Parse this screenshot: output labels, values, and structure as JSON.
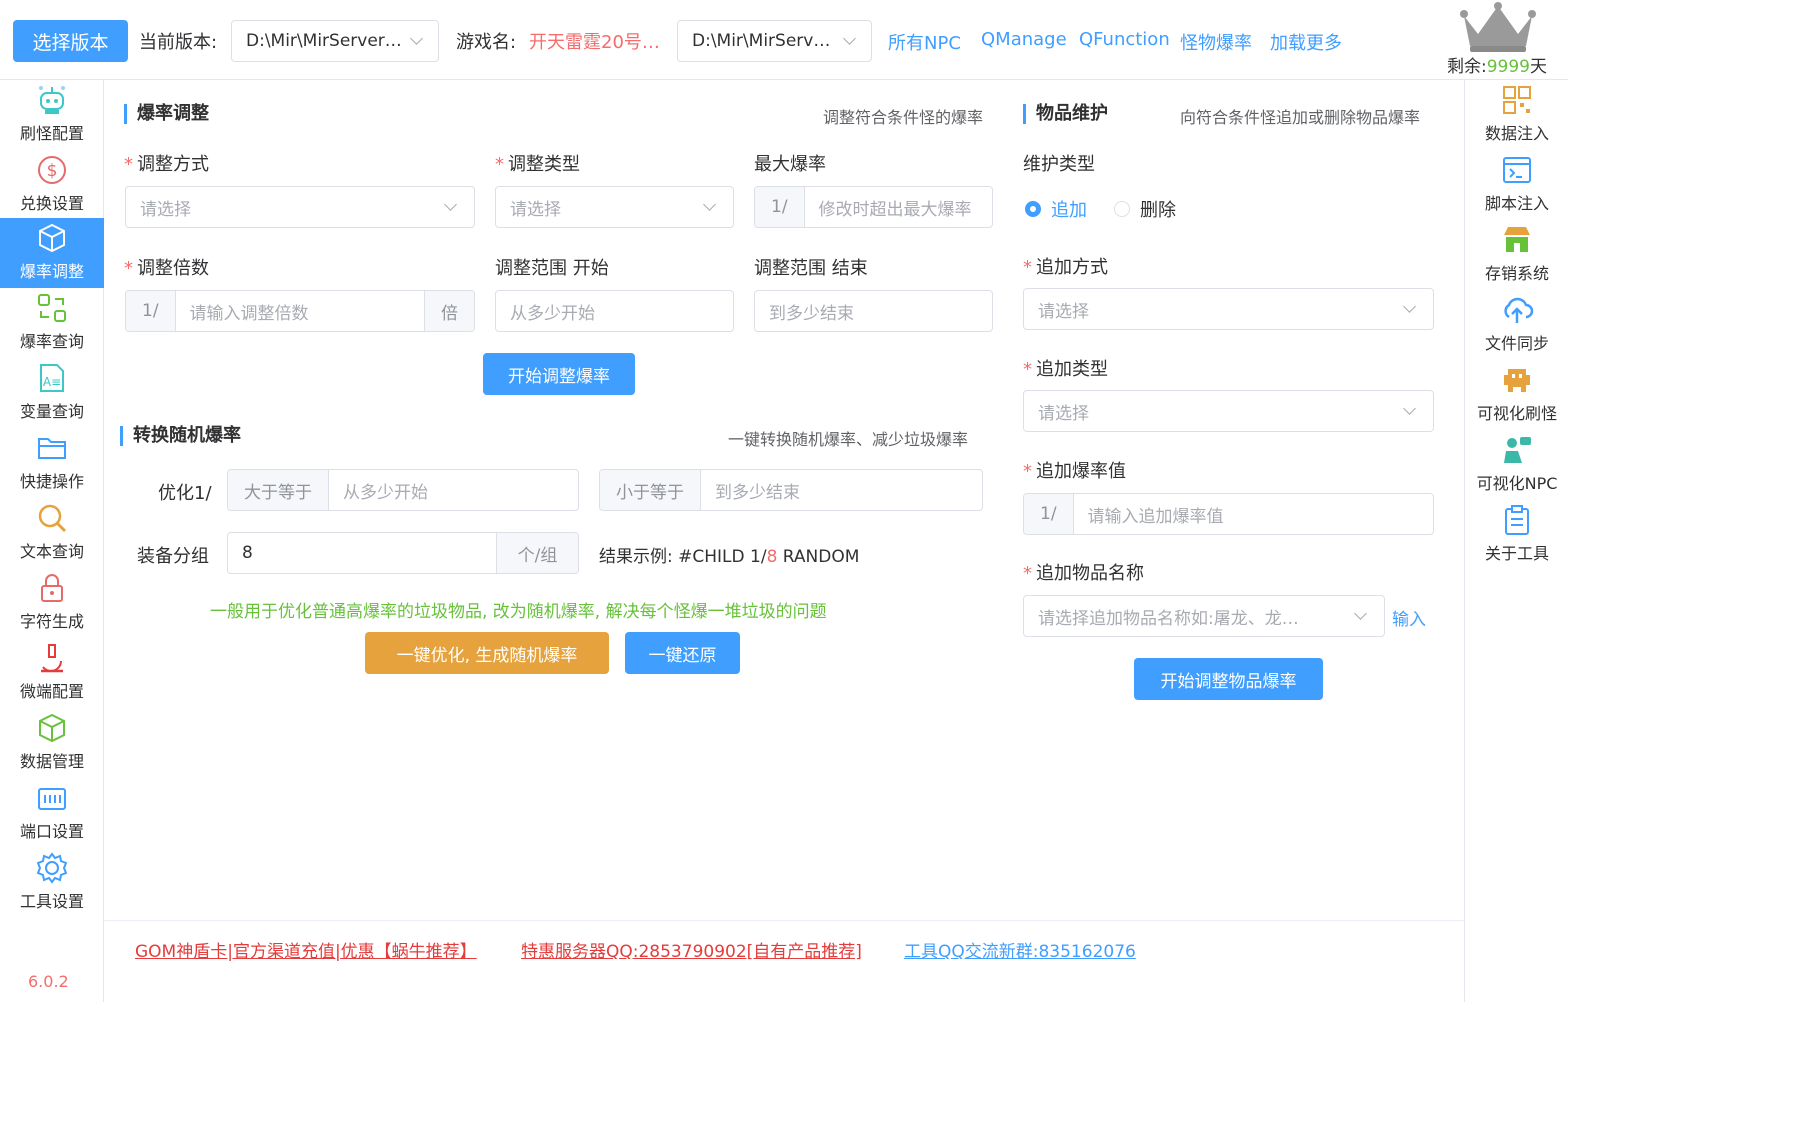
{
  "topbar": {
    "select_version_label": "选择版本",
    "current_version_label": "当前版本:",
    "current_version_value": "D:\\Mir\\MirServer…",
    "game_name_label": "游戏名:",
    "game_name_value": "开天雷霆20号…",
    "path_select_value": "D:\\Mir\\MirServ…",
    "links": [
      "所有NPC",
      "QManage",
      "QFunction",
      "怪物爆率",
      "加载更多"
    ],
    "remain_label": "剩余:",
    "remain_value": "9999",
    "remain_unit": "天"
  },
  "sidebar": {
    "items": [
      {
        "label": "刷怪配置",
        "icon": "robot-icon"
      },
      {
        "label": "兑换设置",
        "icon": "dollar-icon"
      },
      {
        "label": "爆率调整",
        "icon": "cube-icon"
      },
      {
        "label": "爆率查询",
        "icon": "refresh-grid-icon"
      },
      {
        "label": "变量查询",
        "icon": "variable-doc-icon"
      },
      {
        "label": "快捷操作",
        "icon": "folder-icon"
      },
      {
        "label": "文本查询",
        "icon": "search-icon"
      },
      {
        "label": "字符生成",
        "icon": "lock-icon"
      },
      {
        "label": "微端配置",
        "icon": "microscope-icon"
      },
      {
        "label": "数据管理",
        "icon": "box-icon"
      },
      {
        "label": "端口设置",
        "icon": "port-icon"
      },
      {
        "label": "工具设置",
        "icon": "gear-icon"
      }
    ],
    "active_index": 2,
    "version": "6.0.2"
  },
  "rsidebar": {
    "items": [
      {
        "label": "数据注入",
        "icon": "qrcode-icon"
      },
      {
        "label": "脚本注入",
        "icon": "terminal-icon"
      },
      {
        "label": "存销系统",
        "icon": "store-icon"
      },
      {
        "label": "文件同步",
        "icon": "cloud-upload-icon"
      },
      {
        "label": "可视化刷怪",
        "icon": "monster-icon"
      },
      {
        "label": "可视化NPC",
        "icon": "npc-icon"
      },
      {
        "label": "关于工具",
        "icon": "clipboard-icon"
      }
    ]
  },
  "rate": {
    "title": "爆率调整",
    "desc": "调整符合条件怪的爆率",
    "method_label": "调整方式",
    "method_placeholder": "请选择",
    "type_label": "调整类型",
    "type_placeholder": "请选择",
    "max_label": "最大爆率",
    "max_prefix": "1/",
    "max_placeholder": "修改时超出最大爆率",
    "multiplier_label": "调整倍数",
    "multiplier_prefix": "1/",
    "multiplier_placeholder": "请输入调整倍数",
    "multiplier_suffix": "倍",
    "range_start_label": "调整范围 开始",
    "range_start_placeholder": "从多少开始",
    "range_end_label": "调整范围 结束",
    "range_end_placeholder": "到多少结束",
    "start_button": "开始调整爆率"
  },
  "random": {
    "title": "转换随机爆率",
    "desc": "一键转换随机爆率、减少垃圾爆率",
    "optimize_label": "优化1/",
    "gte_prefix": "大于等于",
    "gte_placeholder": "从多少开始",
    "lte_prefix": "小于等于",
    "lte_placeholder": "到多少结束",
    "group_label": "装备分组",
    "group_value": "8",
    "group_suffix": "个/组",
    "example_label": "结果示例:",
    "example_pre": "#CHILD 1/",
    "example_num": "8",
    "example_post": " RANDOM",
    "hint": "一般用于优化普通高爆率的垃圾物品, 改为随机爆率, 解决每个怪爆一堆垃圾的问题",
    "optimize_button": "一键优化, 生成随机爆率",
    "restore_button": "一键还原"
  },
  "item": {
    "title": "物品维护",
    "desc": "向符合条件怪追加或删除物品爆率",
    "maint_type_label": "维护类型",
    "radio_add": "追加",
    "radio_delete": "删除",
    "add_method_label": "追加方式",
    "add_method_placeholder": "请选择",
    "add_type_label": "追加类型",
    "add_type_placeholder": "请选择",
    "add_rate_label": "追加爆率值",
    "add_rate_prefix": "1/",
    "add_rate_placeholder": "请输入追加爆率值",
    "add_name_label": "追加物品名称",
    "add_name_placeholder": "请选择追加物品名称如:屠龙、龙…",
    "input_link": "输入",
    "start_button": "开始调整物品爆率"
  },
  "footer": {
    "link1": "GOM神盾卡|官方渠道充值|优惠【蜗牛推荐】",
    "link2": "特惠服务器QQ:2853790902[自有产品推荐]",
    "link3": "工具QQ交流新群:835162076"
  },
  "colors": {
    "primary": "#409eff",
    "warning": "#e6a23c",
    "danger": "#f56c6c",
    "success": "#67c23a"
  }
}
